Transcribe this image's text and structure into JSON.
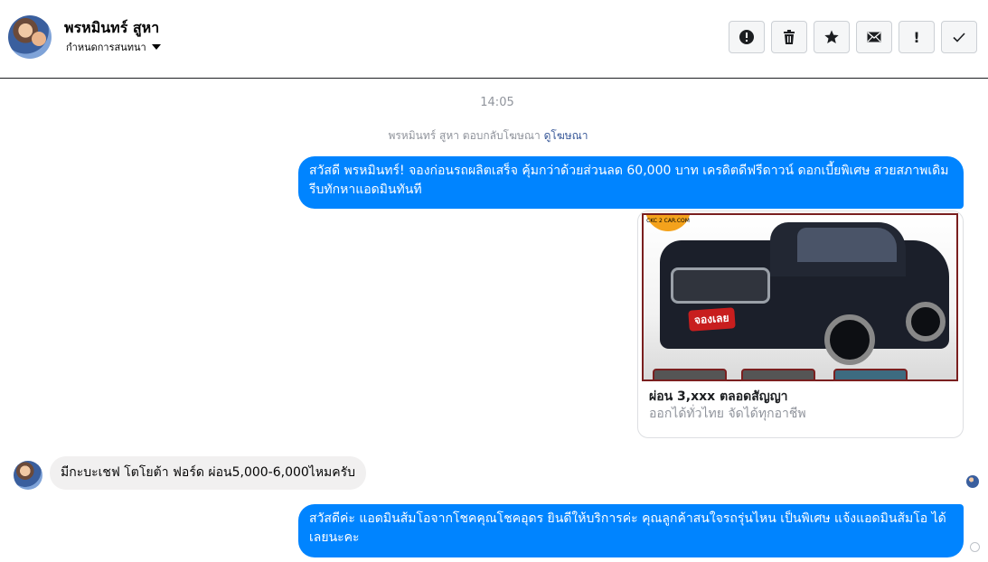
{
  "header": {
    "name": "พรหมินทร์ สูหา",
    "subtitle": "กำหนดการสนทนา",
    "toolbar": {
      "icons": [
        "alert-circle-icon",
        "trash-icon",
        "star-icon",
        "envelope-icon",
        "exclamation-icon",
        "check-icon"
      ],
      "exclamation_glyph": "!"
    }
  },
  "thread": {
    "timestamp": "14:05",
    "reply_note": "พรหมินทร์ สูหา ตอบกลับโฆษณา",
    "reply_link": "ดูโฆษณา",
    "messages": [
      {
        "direction": "out",
        "text": "สวัสดี พรหมินทร์! จองก่อนรถผลิตเสร็จ คุ้มกว่าด้วยส่วนลด 60,000 บาท เครดิตดีฟรีดาวน์ ดอกเบี้ยพิเศษ สวยสภาพเดิม รีบทักหาแอดมินทันที"
      },
      {
        "direction": "out",
        "type": "ad-card",
        "image_stamp": "จองเลย",
        "image_logo": "CKC 2 CAR.COM",
        "title": "ผ่อน 3,xxx ตลอดสัญญา",
        "subtitle": "ออกได้ทั่วไทย จัดได้ทุกอาชีพ"
      },
      {
        "direction": "in",
        "text": "มีกะบะเชฟ โตโยต้า ฟอร์ด ผ่อน5,000-6,000ไหมครับ"
      },
      {
        "direction": "out",
        "text": "สวัสดีค่ะ แอดมินส้มโอจากโชคคุณโชคอุดร ยินดีให้บริการค่ะ   คุณลูกค้าสนใจรถรุ่นไหน เป็นพิเศษ แจ้งแอดมินส้มโอ ได้เลยนะคะ"
      }
    ]
  },
  "colors": {
    "outgoing_bubble": "#0084ff",
    "incoming_bubble": "#f1f0f0",
    "link": "#385898",
    "muted_text": "#90949c"
  }
}
